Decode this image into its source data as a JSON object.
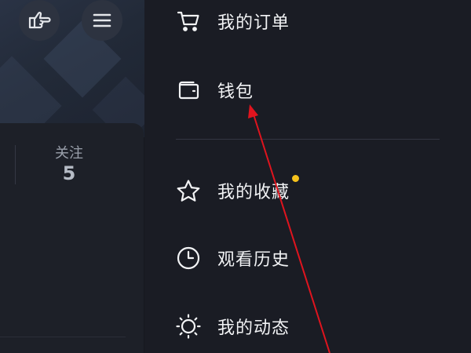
{
  "left_panel": {
    "follow_label": "关注",
    "follow_count": "5",
    "icons": [
      "hand-pointing-icon",
      "hamburger-menu-icon"
    ]
  },
  "drawer": {
    "menu_items": [
      {
        "label": "我的订单",
        "icon": "cart-icon"
      },
      {
        "label": "钱包",
        "icon": "wallet-icon"
      },
      {
        "label": "我的收藏",
        "icon": "star-icon",
        "badge": true
      },
      {
        "label": "观看历史",
        "icon": "clock-icon"
      },
      {
        "label": "我的动态",
        "icon": "sun-icon"
      }
    ]
  },
  "colors": {
    "background": "#1a1c24",
    "text": "#f2f3f5",
    "badge": "#f6c21c",
    "annotation_arrow": "#e0141e"
  }
}
